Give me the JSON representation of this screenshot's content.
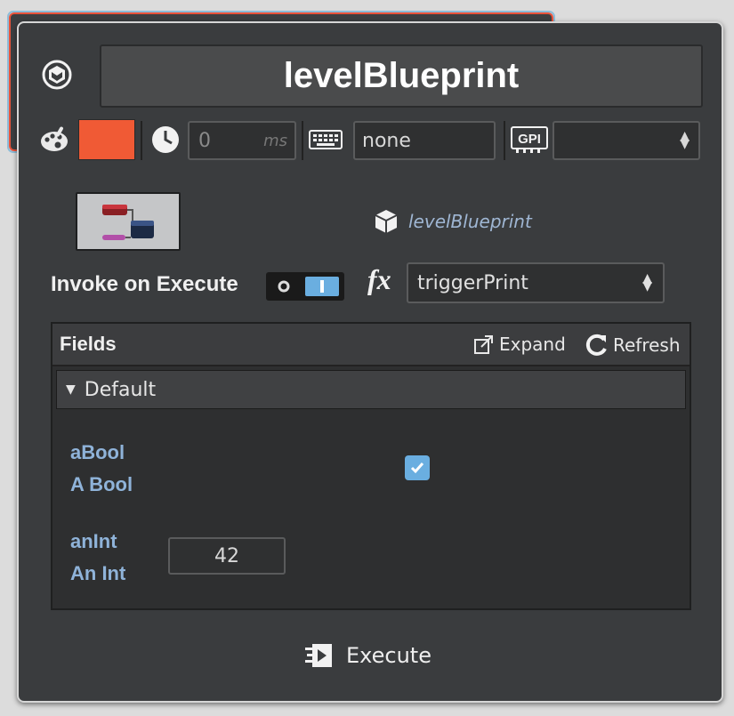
{
  "header": {
    "title": "levelBlueprint"
  },
  "toolbar": {
    "color_value": "#f05a35",
    "delay_value": "0",
    "delay_unit": "ms",
    "keybind_value": "none",
    "gpi_select_value": ""
  },
  "blueprint": {
    "label": "levelBlueprint"
  },
  "invoke": {
    "label": "Invoke on Execute",
    "toggle_on": true,
    "fx_label": "fx",
    "function_value": "triggerPrint"
  },
  "fields": {
    "title": "Fields",
    "expand_label": "Expand",
    "refresh_label": "Refresh",
    "group_label": "Default",
    "items": [
      {
        "name": "aBool",
        "label": "A Bool",
        "type": "checkbox",
        "checked": true
      },
      {
        "name": "anInt",
        "label": "An Int",
        "type": "int",
        "value": "42"
      }
    ]
  },
  "footer": {
    "execute_label": "Execute"
  },
  "colors": {
    "accent_red": "#f05a35",
    "checkbox_blue": "#6aaee0",
    "field_label_blue": "#8fb3d9"
  }
}
